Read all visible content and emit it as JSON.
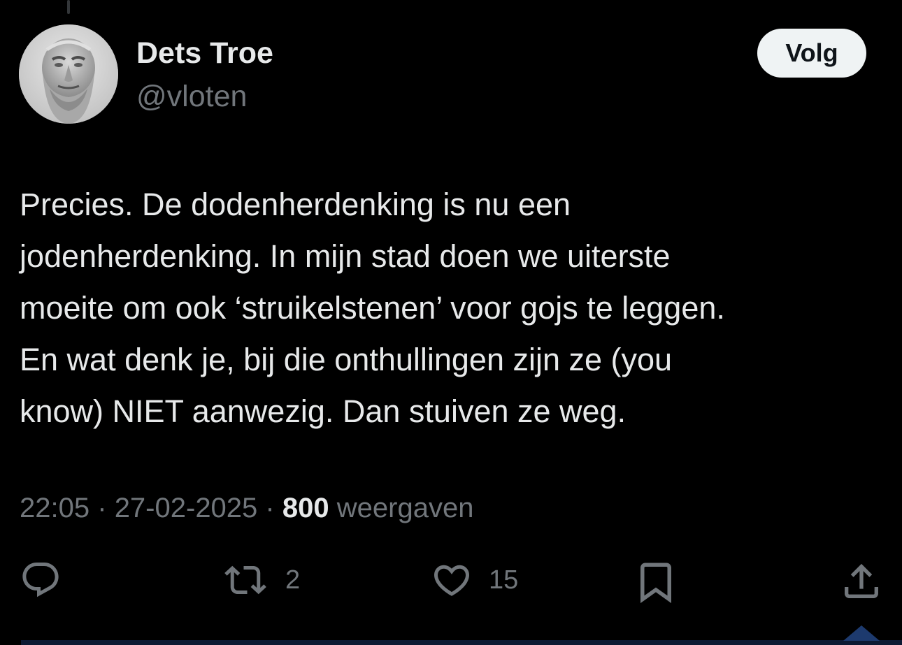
{
  "author": {
    "display_name": "Dets Troe",
    "handle": "@vloten",
    "avatar_icon": "bust-portrait-avatar"
  },
  "follow_button": {
    "label": "Volg"
  },
  "tweet": {
    "text_lines": [
      "Precies. De dodenherdenking is nu een",
      "jodenherdenking. In mijn stad doen we uiterste",
      "moeite om ook ‘struikelstenen’ voor gojs te leggen.",
      "En wat denk je, bij die onthullingen zijn ze (you",
      "know) NIET aanwezig. Dan stuiven ze weg."
    ],
    "time": "22:05",
    "date": "27-02-2025",
    "separator": "·",
    "views_count": "800",
    "views_label": "weergaven"
  },
  "actions": {
    "reply": {
      "icon": "reply-bubble-icon"
    },
    "retweet": {
      "icon": "retweet-icon",
      "count": "2"
    },
    "like": {
      "icon": "heart-icon",
      "count": "15"
    },
    "bookmark": {
      "icon": "bookmark-icon"
    },
    "share": {
      "icon": "share-upload-icon"
    }
  },
  "colors": {
    "background": "#000000",
    "primary_text": "#e7e9ea",
    "secondary_text": "#71767b",
    "button_bg": "#eff3f4",
    "button_text": "#0f1419"
  }
}
